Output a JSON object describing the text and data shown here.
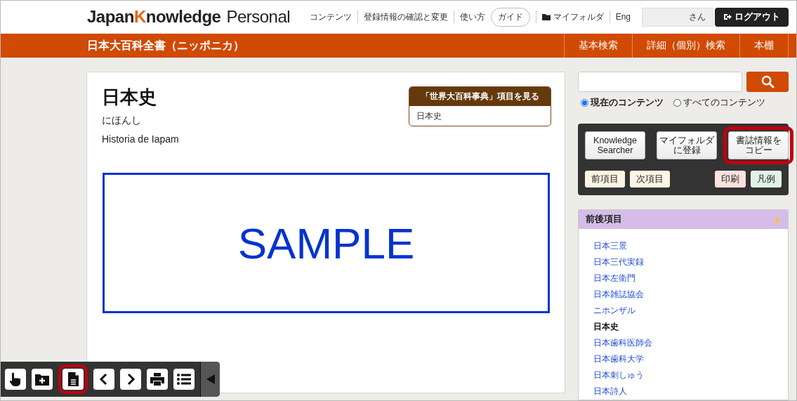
{
  "header": {
    "logo": {
      "part_1": "Japan",
      "part_2": "K",
      "part_3": "nowledge",
      "product": "Personal"
    },
    "links": [
      {
        "kind": "link",
        "label": "コンテンツ"
      },
      {
        "kind": "link",
        "label": "登録情報の確認と変更"
      },
      {
        "kind": "link",
        "label": "使い方"
      },
      {
        "kind": "pill",
        "label": "ガイド"
      },
      {
        "kind": "folder",
        "label": "マイフォルダ"
      },
      {
        "kind": "link",
        "label": "Eng"
      }
    ],
    "user_suffix": "さん",
    "logout": "ログアウト"
  },
  "navbar": {
    "title": "日本大百科全書（ニッポニカ）",
    "items": [
      "基本検索",
      "詳細（個別）検索",
      "本棚"
    ]
  },
  "article": {
    "title": "日本史",
    "reading": "にほんし",
    "foreign": "Historia de Iapam",
    "related": {
      "header": "「世界大百科事典」項目を見る",
      "items": [
        "日本史"
      ]
    },
    "overlay": "SAMPLE"
  },
  "sidebar": {
    "scopes": [
      {
        "label": "現在のコンテンツ",
        "selected": true
      },
      {
        "label": "すべてのコンテンツ",
        "selected": false
      }
    ],
    "actions": [
      {
        "lines": [
          "Knowledge",
          "Searcher"
        ],
        "highlighted": false
      },
      {
        "lines": [
          "マイフォルダ",
          "に登録"
        ],
        "highlighted": false
      },
      {
        "lines": [
          "書誌情報を",
          "コピー"
        ],
        "highlighted": true
      }
    ],
    "small_buttons": [
      {
        "kind": "nav",
        "label": "前項目"
      },
      {
        "kind": "nav",
        "label": "次項目"
      },
      {
        "kind": "print",
        "label": "印刷"
      },
      {
        "kind": "legend",
        "label": "凡例"
      }
    ],
    "adjacent": {
      "title": "前後項目",
      "expanded": true,
      "items": [
        {
          "label": "日本三景",
          "selected": false
        },
        {
          "label": "日本三代実録",
          "selected": false
        },
        {
          "label": "日本左衛門",
          "selected": false
        },
        {
          "label": "日本雑誌協会",
          "selected": false
        },
        {
          "label": "ニホンザル",
          "selected": false
        },
        {
          "label": "日本史",
          "selected": true
        },
        {
          "label": "日本歯科医師会",
          "selected": false
        },
        {
          "label": "日本歯科大学",
          "selected": false
        },
        {
          "label": "日本刺しゅう",
          "selected": false
        },
        {
          "label": "日本詩人",
          "selected": false
        }
      ]
    }
  },
  "toolbar": {
    "tools": [
      {
        "kind": "hand",
        "highlighted": false
      },
      {
        "kind": "folder-add",
        "highlighted": false
      },
      {
        "kind": "document",
        "highlighted": true
      },
      {
        "kind": "prev",
        "highlighted": false
      },
      {
        "kind": "next",
        "highlighted": false
      },
      {
        "kind": "print",
        "highlighted": false
      },
      {
        "kind": "list",
        "highlighted": false
      }
    ],
    "collapsed": false
  }
}
